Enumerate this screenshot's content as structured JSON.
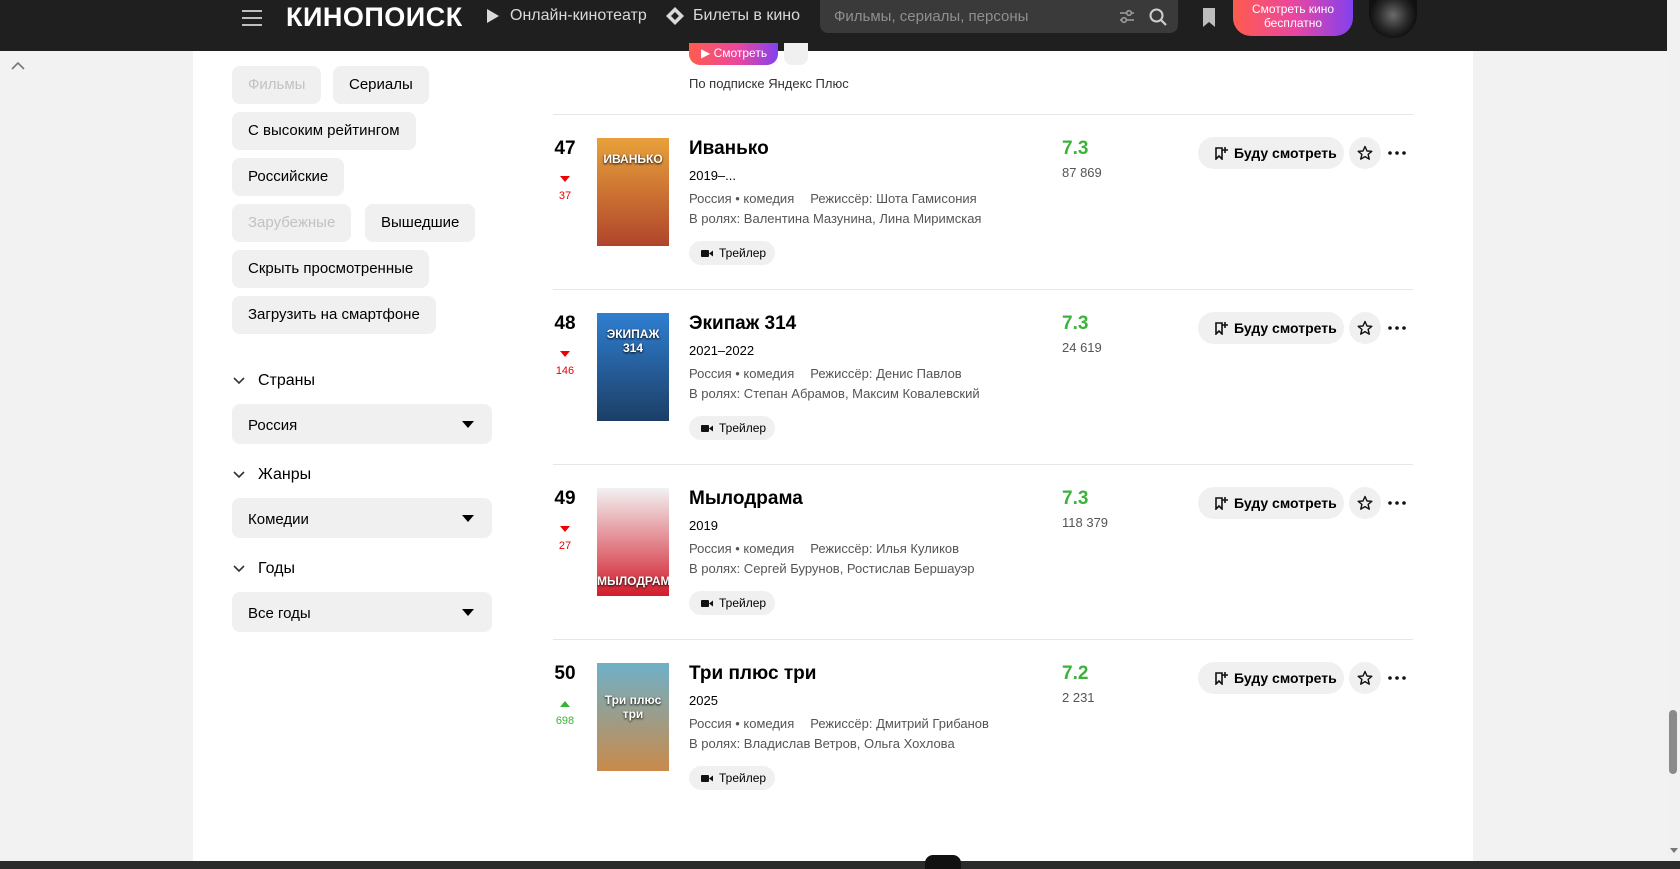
{
  "header": {
    "logo": "КИНОПОИСК",
    "nav": [
      {
        "label": "Онлайн-кинотеатр",
        "icon": "play-icon"
      },
      {
        "label": "Билеты в кино",
        "icon": "ticket-icon"
      }
    ],
    "search_placeholder": "Фильмы, сериалы, персоны",
    "watch_free_label": "Смотреть кино бесплатно"
  },
  "filters": {
    "chips": [
      {
        "label": "Фильмы",
        "disabled": true
      },
      {
        "label": "Сериалы",
        "disabled": false
      },
      {
        "label": "С высоким рейтингом",
        "disabled": false
      },
      {
        "label": "Российские",
        "disabled": false
      },
      {
        "label": "Зарубежные",
        "disabled": true
      },
      {
        "label": "Вышедшие",
        "disabled": false
      },
      {
        "label": "Скрыть просмотренные",
        "disabled": false
      },
      {
        "label": "Загрузить на смартфоне",
        "disabled": false
      }
    ],
    "countries": {
      "title": "Страны",
      "value": "Россия"
    },
    "genres": {
      "title": "Жанры",
      "value": "Комедии"
    },
    "years": {
      "title": "Годы",
      "value": "Все годы"
    }
  },
  "fragment": {
    "watch_label": "▶ Смотреть",
    "subscription": "По подписке Яндекс Плюс"
  },
  "films": [
    {
      "rank": "47",
      "delta": "37",
      "direction": "down",
      "title": "Иванько",
      "year": "2019–...",
      "country_genre": "Россия • комедия",
      "director": "Режиссёр: Шота Гамисония",
      "cast": "В ролях: Валентина Мазунина, Лина Миримская",
      "rating": "7.3",
      "votes": "87 869",
      "poster_title": "ИВАНЬКО",
      "poster_colors": [
        "#e8a13a",
        "#b0452c"
      ]
    },
    {
      "rank": "48",
      "delta": "146",
      "direction": "down",
      "title": "Экипаж 314",
      "year": "2021–2022",
      "country_genre": "Россия • комедия",
      "director": "Режиссёр: Денис Павлов",
      "cast": "В ролях: Степан Абрамов, Максим Ковалевский",
      "rating": "7.3",
      "votes": "24 619",
      "poster_title": "ЭКИПАЖ 314",
      "poster_colors": [
        "#2f7fd1",
        "#1c3e66"
      ]
    },
    {
      "rank": "49",
      "delta": "27",
      "direction": "down",
      "title": "Мылодрама",
      "year": "2019",
      "country_genre": "Россия • комедия",
      "director": "Режиссёр: Илья Куликов",
      "cast": "В ролях: Сергей Бурунов, Ростислав Бершауэр",
      "rating": "7.3",
      "votes": "118 379",
      "poster_title": "МЫЛОДРАМА",
      "poster_colors": [
        "#f2f2f2",
        "#d21c2a"
      ]
    },
    {
      "rank": "50",
      "delta": "698",
      "direction": "up",
      "title": "Три плюс три",
      "year": "2025",
      "country_genre": "Россия • комедия",
      "director": "Режиссёр: Дмитрий Грибанов",
      "cast": "В ролях: Владислав Ветров, Ольга Хохлова",
      "rating": "7.2",
      "votes": "2 231",
      "poster_title": "Три плюс три",
      "poster_colors": [
        "#6fb0c9",
        "#c98a4a"
      ]
    }
  ],
  "actions": {
    "trailer_label": "Трейлер",
    "will_watch_label": "Буду смотреть"
  },
  "colors": {
    "header_bg": "#1f1f1f",
    "rating_green": "#3bb33b",
    "delta_red": "#ee0000",
    "accent_gradient": [
      "#ff5c4d",
      "#eb469f",
      "#8341ef"
    ]
  }
}
